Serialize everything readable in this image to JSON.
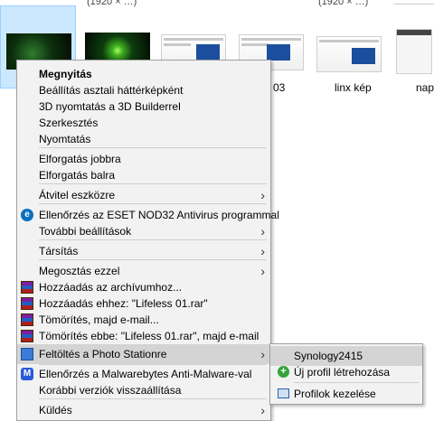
{
  "files": {
    "top_clipped": [
      "(1920 × …)",
      "(1920 × …)"
    ],
    "labels": [
      "03",
      "linx kép",
      "naplo"
    ]
  },
  "menu": {
    "items": [
      {
        "label": "Megnyitás"
      },
      {
        "label": "Beállítás asztali háttérképként"
      },
      {
        "label": "3D nyomtatás a 3D Builderrel"
      },
      {
        "label": "Szerkesztés"
      },
      {
        "label": "Nyomtatás"
      },
      {
        "label": "Elforgatás jobbra"
      },
      {
        "label": "Elforgatás balra"
      },
      {
        "label": "Átvitel eszközre"
      },
      {
        "label": "Ellenőrzés az ESET NOD32 Antivirus programmal"
      },
      {
        "label": "További beállítások"
      },
      {
        "label": "Társítás"
      },
      {
        "label": "Megosztás ezzel"
      },
      {
        "label": "Hozzáadás az archívumhoz..."
      },
      {
        "label": "Hozzáadás ehhez: \"Lifeless 01.rar\""
      },
      {
        "label": "Tömörítés, majd e-mail..."
      },
      {
        "label": "Tömörítés ebbe: \"Lifeless 01.rar\", majd e-mail"
      },
      {
        "label": "Feltöltés a Photo Stationre"
      },
      {
        "label": "Ellenőrzés a Malwarebytes Anti-Malware-val"
      },
      {
        "label": "Korábbi verziók visszaállítása"
      },
      {
        "label": "Küldés"
      }
    ]
  },
  "submenu": {
    "items": [
      {
        "label": "Synology2415"
      },
      {
        "label": "Új profil létrehozása"
      },
      {
        "label": "Profilok kezelése"
      }
    ]
  },
  "icons": {
    "chevron": "›",
    "eset": "e",
    "malwarebytes": "M",
    "plus": "+"
  },
  "colors": {
    "menu_bg": "#f2f2f2",
    "highlight": "#d4d4d4",
    "selection": "#cce8ff"
  }
}
